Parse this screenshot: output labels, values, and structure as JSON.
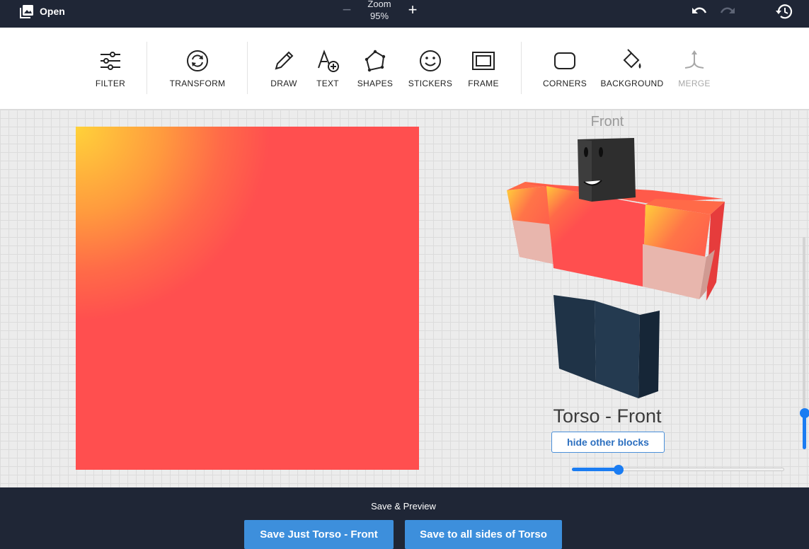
{
  "topbar": {
    "open_label": "Open",
    "zoom_label": "Zoom",
    "zoom_value": "95%",
    "zoom_minus_icon": "minus-icon",
    "zoom_plus_icon": "plus-icon",
    "undo_icon": "undo-icon",
    "redo_icon": "redo-icon",
    "history_icon": "history-icon"
  },
  "toolbar": {
    "tools": [
      {
        "label": "FILTER",
        "icon": "sliders-icon",
        "enabled": true
      },
      {
        "label": "TRANSFORM",
        "icon": "rotate-icon",
        "enabled": true
      },
      {
        "label": "DRAW",
        "icon": "pencil-icon",
        "enabled": true
      },
      {
        "label": "TEXT",
        "icon": "text-add-icon",
        "enabled": true
      },
      {
        "label": "SHAPES",
        "icon": "polygon-icon",
        "enabled": true
      },
      {
        "label": "STICKERS",
        "icon": "smiley-icon",
        "enabled": true
      },
      {
        "label": "FRAME",
        "icon": "frame-icon",
        "enabled": true
      },
      {
        "label": "CORNERS",
        "icon": "rounded-square-icon",
        "enabled": true
      },
      {
        "label": "BACKGROUND",
        "icon": "paint-bucket-icon",
        "enabled": true
      },
      {
        "label": "MERGE",
        "icon": "merge-icon",
        "enabled": false
      }
    ]
  },
  "preview": {
    "view_label": "Front",
    "part_title": "Torso - Front",
    "hide_button": "hide other blocks",
    "horizontal_slider_fraction": 0.22,
    "vertical_slider_fraction": 0.17
  },
  "colors": {
    "topbar_bg": "#1f2636",
    "canvas_fill": "#ff4f4f",
    "gradient_corner": "#ffd23a",
    "accent": "#1a7cf2",
    "button_blue": "#3d8fdc",
    "pants": "#1f3347",
    "skin": "#e8b6ad",
    "head": "#2e2e2e"
  },
  "bottombar": {
    "caption": "Save & Preview",
    "save_one": "Save Just Torso - Front",
    "save_all": "Save to all sides of Torso"
  }
}
